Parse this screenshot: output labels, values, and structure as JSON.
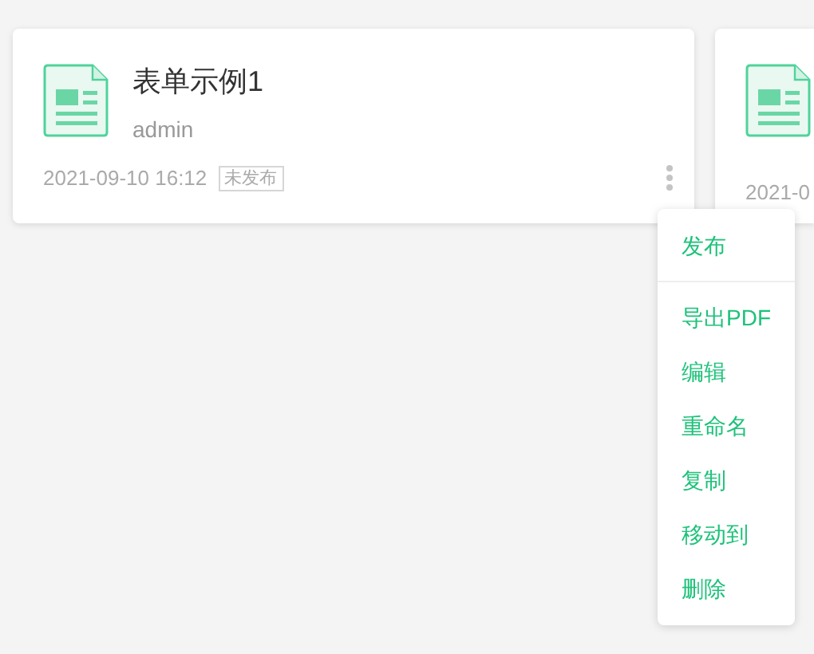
{
  "cards": [
    {
      "title": "表单示例1",
      "author": "admin",
      "date": "2021-09-10 16:12",
      "status": "未发布"
    },
    {
      "date": "2021-0"
    }
  ],
  "menu": {
    "groups": [
      [
        "发布"
      ],
      [
        "导出PDF",
        "编辑",
        "重命名",
        "复制",
        "移动到",
        "删除"
      ]
    ]
  }
}
